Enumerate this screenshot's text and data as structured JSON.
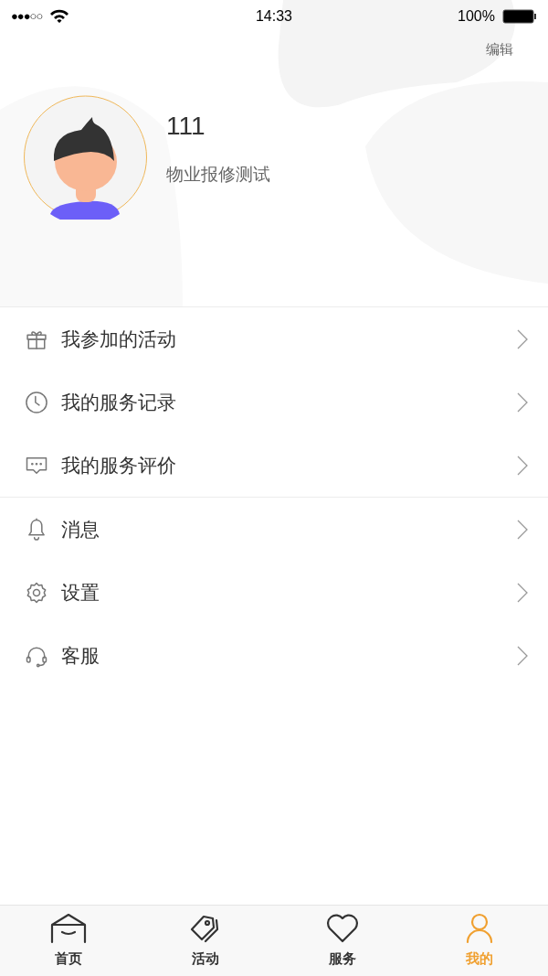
{
  "status_bar": {
    "signal_text": "●●●○○",
    "time": "14:33",
    "battery": "100%"
  },
  "header": {
    "edit": "编辑",
    "name": "111",
    "subtitle": "物业报修测试"
  },
  "menu_groups": [
    {
      "items": [
        {
          "kind": "gift",
          "label": "我参加的活动"
        },
        {
          "kind": "clock",
          "label": "我的服务记录"
        },
        {
          "kind": "chat",
          "label": "我的服务评价"
        }
      ]
    },
    {
      "items": [
        {
          "kind": "bell",
          "label": "消息"
        },
        {
          "kind": "gear",
          "label": "设置"
        },
        {
          "kind": "headset",
          "label": "客服"
        }
      ]
    }
  ],
  "tab_bar": [
    {
      "kind": "home",
      "label": "首页",
      "selected": false
    },
    {
      "kind": "tag",
      "label": "活动",
      "selected": false
    },
    {
      "kind": "heart",
      "label": "服务",
      "selected": false
    },
    {
      "kind": "person",
      "label": "我的",
      "selected": true
    }
  ]
}
